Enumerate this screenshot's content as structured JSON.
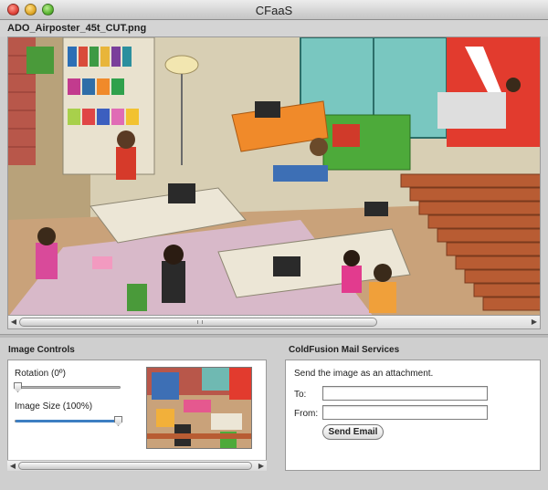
{
  "window": {
    "title": "CFaaS"
  },
  "image": {
    "file_name": "ADO_Airposter_45t_CUT.png"
  },
  "image_controls": {
    "title": "Image Controls",
    "rotation_label": "Rotation (0º)",
    "rotation_value": 0,
    "size_label": "Image Size (100%)",
    "size_value": 100
  },
  "mail": {
    "title": "ColdFusion Mail Services",
    "instruction": "Send the image as an attachment.",
    "to_label": "To:",
    "to_value": "",
    "from_label": "From:",
    "from_value": "",
    "send_label": "Send Email"
  },
  "colors": {
    "accent": "#3d7ec2",
    "adobe_red": "#e23b2e",
    "floor_wood": "#c86a3c",
    "wall_teal": "#2d9a8f"
  },
  "icons": {
    "close": "close-icon",
    "minimize": "minimize-icon",
    "zoom": "zoom-icon",
    "scroll_left": "arrow-left-icon",
    "scroll_right": "arrow-right-icon",
    "scroll_grip": "grip-icon"
  }
}
